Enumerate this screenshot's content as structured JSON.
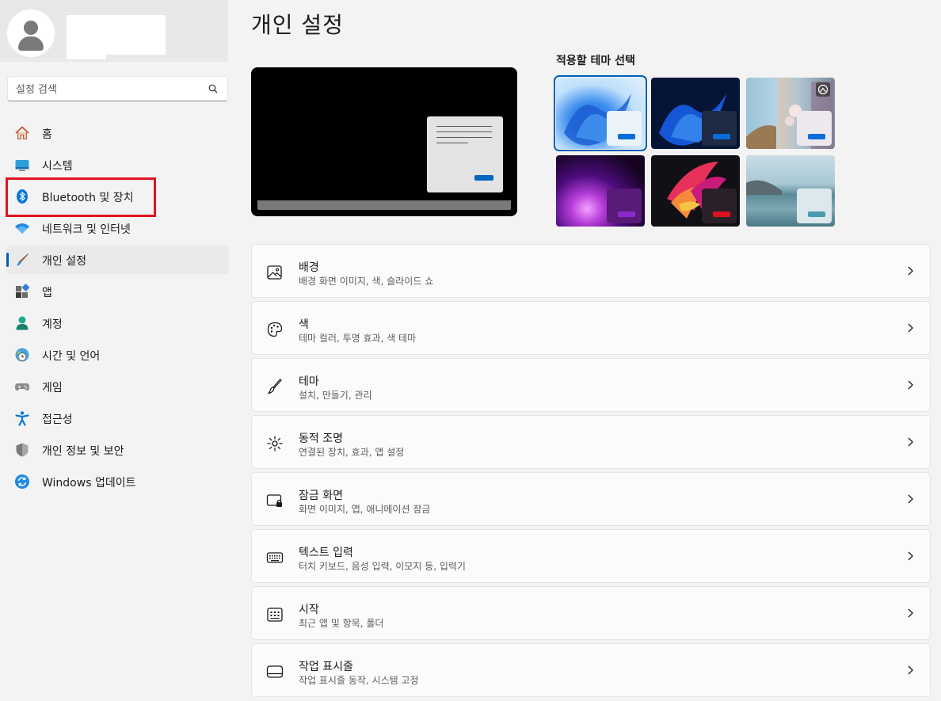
{
  "page_title": "개인 설정",
  "search": {
    "placeholder": "설정 검색"
  },
  "nav": [
    {
      "label": "홈",
      "icon": "home-icon"
    },
    {
      "label": "시스템",
      "icon": "system-icon"
    },
    {
      "label": "Bluetooth 및 장치",
      "icon": "bluetooth-icon"
    },
    {
      "label": "네트워크 및 인터넷",
      "icon": "wifi-icon"
    },
    {
      "label": "개인 설정",
      "icon": "brush-icon",
      "active": true
    },
    {
      "label": "앱",
      "icon": "apps-icon"
    },
    {
      "label": "계정",
      "icon": "account-icon"
    },
    {
      "label": "시간 및 언어",
      "icon": "globe-clock-icon"
    },
    {
      "label": "게임",
      "icon": "gamepad-icon"
    },
    {
      "label": "접근성",
      "icon": "accessibility-icon"
    },
    {
      "label": "개인 정보 및 보안",
      "icon": "shield-icon"
    },
    {
      "label": "Windows 업데이트",
      "icon": "update-icon"
    }
  ],
  "theme_section": {
    "label": "적용할 테마 선택"
  },
  "themes": [
    {
      "name": "windows-light",
      "selected": true
    },
    {
      "name": "windows-dark"
    },
    {
      "name": "spotlight"
    },
    {
      "name": "glow"
    },
    {
      "name": "captured-motion"
    },
    {
      "name": "flow"
    }
  ],
  "settings": [
    {
      "title": "배경",
      "subtitle": "배경 화면 이미지, 색, 슬라이드 쇼",
      "icon": "picture-icon"
    },
    {
      "title": "색",
      "subtitle": "테마 컬러, 투명 효과, 색 테마",
      "icon": "palette-icon"
    },
    {
      "title": "테마",
      "subtitle": "설치, 만들기, 관리",
      "icon": "brush-icon"
    },
    {
      "title": "동적 조명",
      "subtitle": "연결된 장치, 효과, 앱 설정",
      "icon": "dynamic-lighting-icon"
    },
    {
      "title": "잠금 화면",
      "subtitle": "화면 이미지, 앱, 애니메이션 잠금",
      "icon": "lock-screen-icon"
    },
    {
      "title": "텍스트 입력",
      "subtitle": "터치 키보드, 음성 입력, 이모지 등, 입력기",
      "icon": "keyboard-icon"
    },
    {
      "title": "시작",
      "subtitle": "최근 앱 및 항목, 폴더",
      "icon": "start-icon"
    },
    {
      "title": "작업 표시줄",
      "subtitle": "작업 표시줄 동작, 시스템 고정",
      "icon": "taskbar-icon"
    }
  ],
  "colors": {
    "accent": "#005fb8",
    "highlight_box": "#e0141e"
  }
}
